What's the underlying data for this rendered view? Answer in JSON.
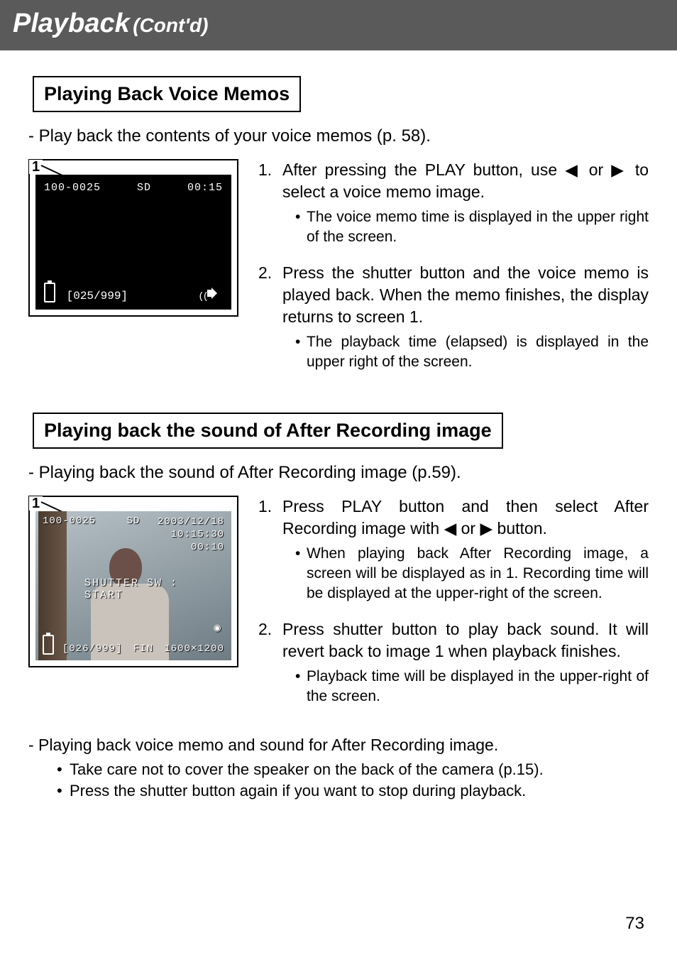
{
  "header": {
    "main": "Playback",
    "sub": "(Cont'd)"
  },
  "section1": {
    "title": "Playing Back Voice Memos",
    "intro": "- Play back the contents of your voice memos (p. 58).",
    "screen": {
      "number": "1",
      "file_id": "100-0025",
      "media": "SD",
      "time": "00:15",
      "counter": "[025/999]"
    },
    "steps": [
      {
        "text_pre": "After pressing the PLAY button, use ",
        "text_post": " to select a voice memo image.",
        "arrows": "◀ or ▶",
        "bullets": [
          "The voice memo time is displayed in the upper right of the screen."
        ]
      },
      {
        "text_full": "Press the shutter button and the voice memo is played back. When the memo finishes, the display returns to screen 1.",
        "bullets": [
          "The playback time (elapsed) is displayed in the upper right of the screen."
        ]
      }
    ]
  },
  "section2": {
    "title": "Playing back the sound of After Recording image",
    "intro": "- Playing back the sound of After Recording image (p.59).",
    "screen": {
      "number": "1",
      "file_id": "100-0025",
      "media": "SD",
      "date": "2003/12/18",
      "clock": "10:15:30",
      "rec_time": "00:10",
      "center": "SHUTTER SW : START",
      "counter": "[026/999]",
      "quality": "FIN",
      "resolution": "1600×1200"
    },
    "steps": [
      {
        "text_pre": "Press PLAY button and then select After Recording image with ",
        "text_post": " button.",
        "arrows": "◀ or ▶",
        "bullets": [
          "When playing back After Recording image, a screen will be displayed as in 1. Recording time will be displayed at the upper-right of the screen."
        ]
      },
      {
        "text_full": "Press shutter button to play back sound. It will revert back to image 1 when playback finishes.",
        "bullets": [
          "Playback time will be displayed in the upper-right of the screen."
        ]
      }
    ]
  },
  "footer": {
    "intro": "- Playing back voice memo and sound for After Recording image.",
    "bullets": [
      "Take care not to cover the speaker on the back of the camera (p.15).",
      "Press the shutter button again if you want to stop during playback."
    ]
  },
  "page_number": "73"
}
